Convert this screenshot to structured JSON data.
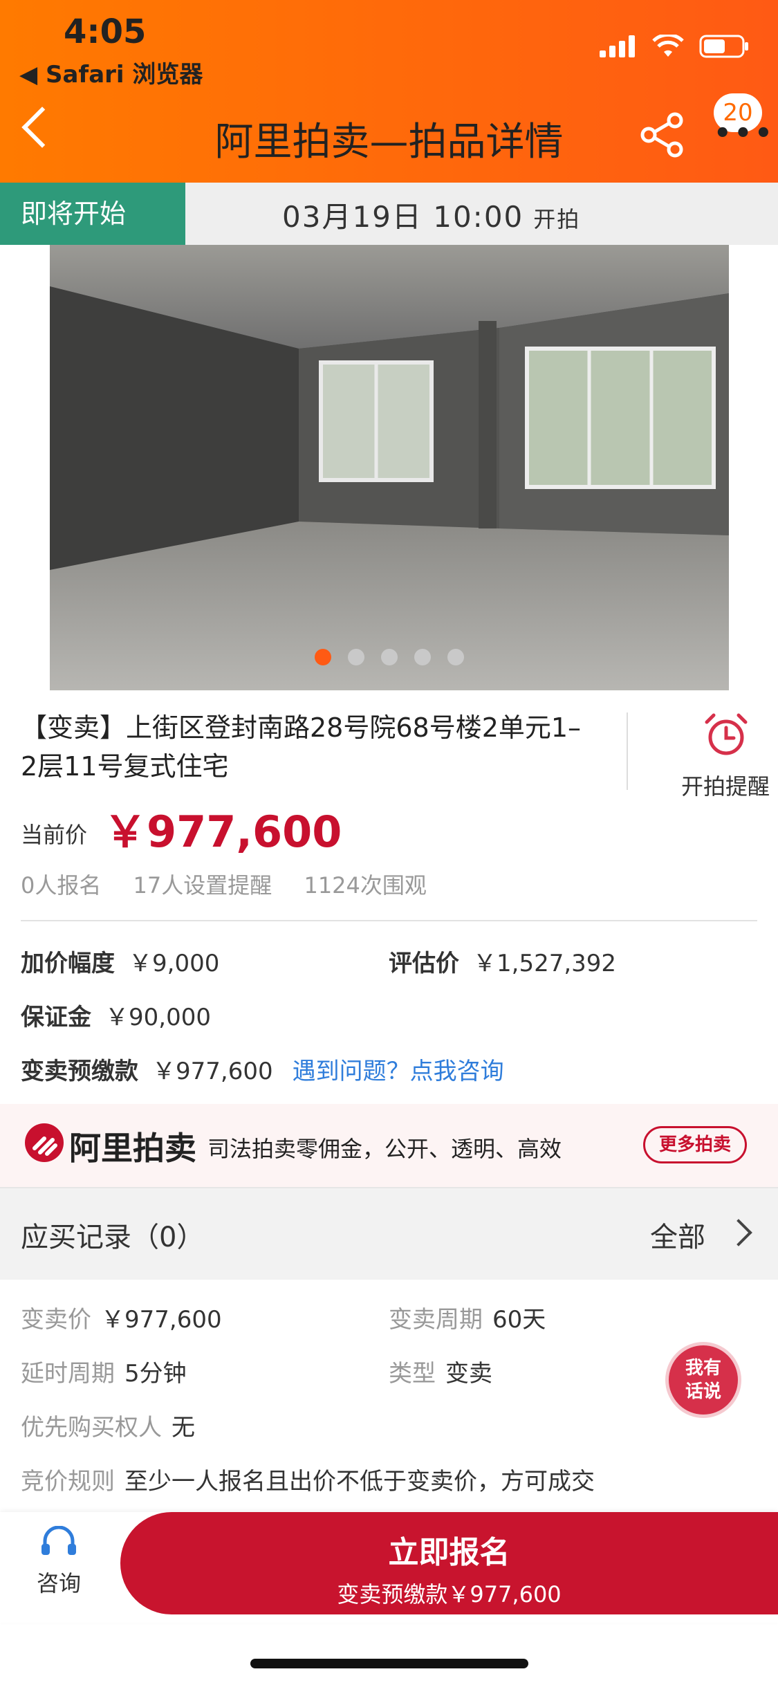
{
  "status_bar": {
    "time": "4:05",
    "back_app": "◀ Safari 浏览器"
  },
  "nav": {
    "title": "阿里拍卖—拍品详情",
    "notification_count": "20",
    "more": "•••"
  },
  "auction_status": {
    "tag": "即将开始",
    "start_time": "03月19日 10:00",
    "start_suffix": "开拍"
  },
  "gallery": {
    "total_images": 5,
    "current_index": 1
  },
  "item": {
    "title": "【变卖】上街区登封南路28号院68号楼2单元1–2层11号复式住宅",
    "reminder_label": "开拍提醒",
    "current_price_label": "当前价",
    "current_price": "￥977,600",
    "stats": {
      "signups": "0人报名",
      "reminders": "17人设置提醒",
      "views": "1124次围观"
    },
    "increment_label": "加价幅度",
    "increment_value": "￥9,000",
    "appraisal_label": "评估价",
    "appraisal_value": "￥1,527,392",
    "deposit_label": "保证金",
    "deposit_value": "￥90,000",
    "prepay_label": "变卖预缴款",
    "prepay_value": "￥977,600",
    "consult_link": "遇到问题？点我咨询"
  },
  "banner": {
    "brand": "阿里拍卖",
    "slogan": "司法拍卖零佣金，公开、透明、高效",
    "more_button": "更多拍卖"
  },
  "records": {
    "title": "应买记录（0）",
    "all": "全部"
  },
  "info": {
    "sale_price_label": "变卖价",
    "sale_price_value": "￥977,600",
    "period_label": "变卖周期",
    "period_value": "60天",
    "delay_label": "延时周期",
    "delay_value": "5分钟",
    "type_label": "类型",
    "type_value": "变卖",
    "priority_label": "优先购买权人",
    "priority_value": "无",
    "rule_label": "竞价规则",
    "rule_value": "至少一人报名且出价不低于变卖价，方可成交"
  },
  "talk_button": {
    "line1": "我有",
    "line2": "话说"
  },
  "bottom": {
    "consult_label": "咨询",
    "signup_main": "立即报名",
    "signup_sub": "变卖预缴款￥977,600"
  },
  "colors": {
    "accent_orange": "#ff6a00",
    "status_green": "#2e9a7a",
    "price_red": "#c8102e",
    "link_blue": "#2f7ddb"
  }
}
